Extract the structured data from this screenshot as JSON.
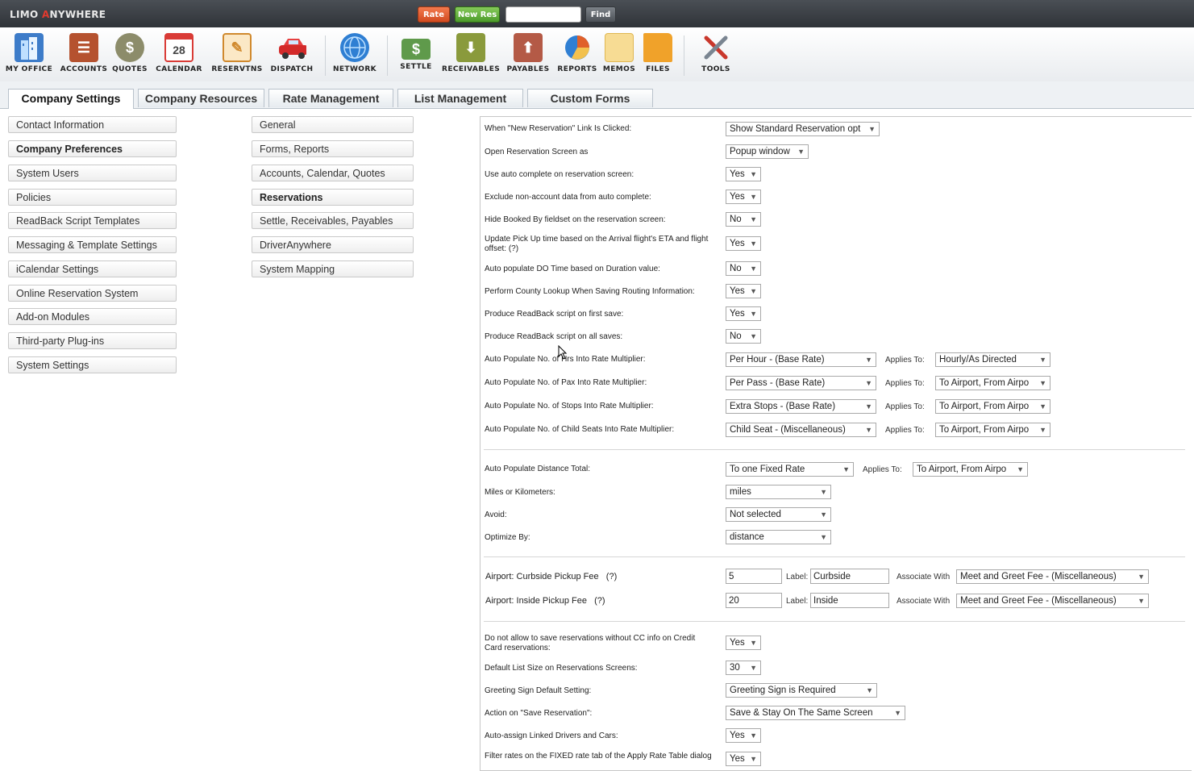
{
  "app": {
    "logo_prefix": "LIMO ",
    "logo_a": "A",
    "logo_suffix": "NYWHERE"
  },
  "topbar": {
    "rate": "Rate",
    "new_res": "New Res",
    "find": "Find",
    "search_value": ""
  },
  "toolbar": [
    {
      "label": "MY OFFICE",
      "icon": "building-icon",
      "color": "#3d7cc9"
    },
    {
      "label": "ACCOUNTS",
      "icon": "address-book-icon",
      "color": "#b5522f"
    },
    {
      "label": "QUOTES",
      "icon": "money-bag-icon",
      "color": "#8c8c6a"
    },
    {
      "label": "CALENDAR",
      "icon": "calendar-icon",
      "color": "#d93b36",
      "num": "28"
    },
    {
      "label": "RESERVTNS",
      "icon": "notepad-icon",
      "color": "#d0892d"
    },
    {
      "label": "DISPATCH",
      "icon": "car-icon",
      "color": "#d32a2a"
    },
    {
      "label": "NETWORK",
      "icon": "globe-icon",
      "color": "#2f7fd3"
    },
    {
      "label": "SETTLE",
      "icon": "cash-icon",
      "color": "#5f9a4b"
    },
    {
      "label": "RECEIVABLES",
      "icon": "receivables-icon",
      "color": "#8a9a3c"
    },
    {
      "label": "PAYABLES",
      "icon": "payables-icon",
      "color": "#b45a46"
    },
    {
      "label": "REPORTS",
      "icon": "pie-chart-icon",
      "color": "#e0602a"
    },
    {
      "label": "MEMOS",
      "icon": "memo-icon",
      "color": "#f2c14e"
    },
    {
      "label": "FILES",
      "icon": "folder-icon",
      "color": "#f0a22a"
    },
    {
      "label": "TOOLS",
      "icon": "tools-icon",
      "color": "#c9372c"
    }
  ],
  "tabs": [
    "Company Settings",
    "Company Resources",
    "Rate Management",
    "List Management",
    "Custom Forms"
  ],
  "left_nav": [
    "Contact Information",
    "Company Preferences",
    "System Users",
    "Policies",
    "ReadBack Script Templates",
    "Messaging & Template Settings",
    "iCalendar Settings",
    "Online Reservation System",
    "Add-on Modules",
    "Third-party Plug-ins",
    "System Settings"
  ],
  "mid_nav": [
    "General",
    "Forms, Reports",
    "Accounts, Calendar, Quotes",
    "Reservations",
    "Settle, Receivables, Payables",
    "DriverAnywhere",
    "System Mapping"
  ],
  "settings": {
    "new_res_link": {
      "label": "When \"New Reservation\" Link Is Clicked:",
      "value": "Show Standard Reservation opt"
    },
    "open_screen": {
      "label": "Open Reservation Screen as",
      "value": "Popup window"
    },
    "autocomplete": {
      "label": "Use auto complete on reservation screen:",
      "value": "Yes"
    },
    "exclude_nonaccount": {
      "label": "Exclude non-account data from auto complete:",
      "value": "Yes"
    },
    "hide_booked": {
      "label": "Hide Booked By fieldset on the reservation screen:",
      "value": "No"
    },
    "update_pickup": {
      "label1": "Update Pick Up time based on the Arrival flight's ETA and flight",
      "label2": "offset: (?)",
      "value": "Yes"
    },
    "auto_do_time": {
      "label": "Auto populate DO Time based on Duration value:",
      "value": "No"
    },
    "county_lookup": {
      "label": "Perform County Lookup When Saving Routing Information:",
      "value": "Yes"
    },
    "readback_first": {
      "label": "Produce ReadBack script on first save:",
      "value": "Yes"
    },
    "readback_all": {
      "label": "Produce ReadBack script on all saves:",
      "value": "No"
    },
    "applies_to": "Applies To:",
    "hrs_multiplier": {
      "label": "Auto Populate No. of Hrs Into Rate Multiplier:",
      "value": "Per Hour - (Base Rate)",
      "applies": "Hourly/As Directed"
    },
    "pax_multiplier": {
      "label": "Auto Populate No. of Pax Into Rate Multiplier:",
      "value": "Per Pass - (Base Rate)",
      "applies": "To Airport, From Airpo"
    },
    "stops_multiplier": {
      "label": "Auto Populate No. of Stops Into Rate Multiplier:",
      "value": "Extra Stops - (Base Rate)",
      "applies": "To Airport, From Airpo"
    },
    "seats_multiplier": {
      "label": "Auto Populate No. of Child Seats Into Rate Multiplier:",
      "value": "Child Seat - (Miscellaneous)",
      "applies": "To Airport, From Airpo"
    },
    "distance_total": {
      "label": "Auto Populate Distance Total:",
      "value": "To one Fixed Rate",
      "applies": "To Airport, From Airpo"
    },
    "miles_km": {
      "label": "Miles or Kilometers:",
      "value": "miles"
    },
    "avoid": {
      "label": "Avoid:",
      "value": "Not selected"
    },
    "optimize": {
      "label": "Optimize By:",
      "value": "distance"
    },
    "curbside": {
      "label": "Airport: Curbside Pickup Fee",
      "help": "(?)",
      "fee": "5",
      "label_text": "Label:",
      "label_value": "Curbside",
      "assoc": "Associate With",
      "assoc_value": "Meet and Greet Fee - (Miscellaneous)"
    },
    "inside": {
      "label": "Airport: Inside Pickup Fee",
      "help": "(?)",
      "fee": "20",
      "label_text": "Label:",
      "label_value": "Inside",
      "assoc": "Associate With",
      "assoc_value": "Meet and Greet Fee - (Miscellaneous)"
    },
    "no_cc": {
      "label1": "Do not allow to save reservations without CC info on Credit",
      "label2": "Card reservations:",
      "value": "Yes"
    },
    "list_size": {
      "label": "Default List Size on Reservations Screens:",
      "value": "30"
    },
    "greeting_sign": {
      "label": "Greeting Sign Default Setting:",
      "value": "Greeting Sign is Required"
    },
    "save_action": {
      "label": "Action on \"Save Reservation\":",
      "value": "Save & Stay On The Same Screen"
    },
    "auto_assign": {
      "label": "Auto-assign Linked Drivers and Cars:",
      "value": "Yes"
    },
    "filter_rates": {
      "label": "Filter rates on the FIXED rate tab of the Apply Rate Table dialog",
      "value": "Yes"
    }
  }
}
